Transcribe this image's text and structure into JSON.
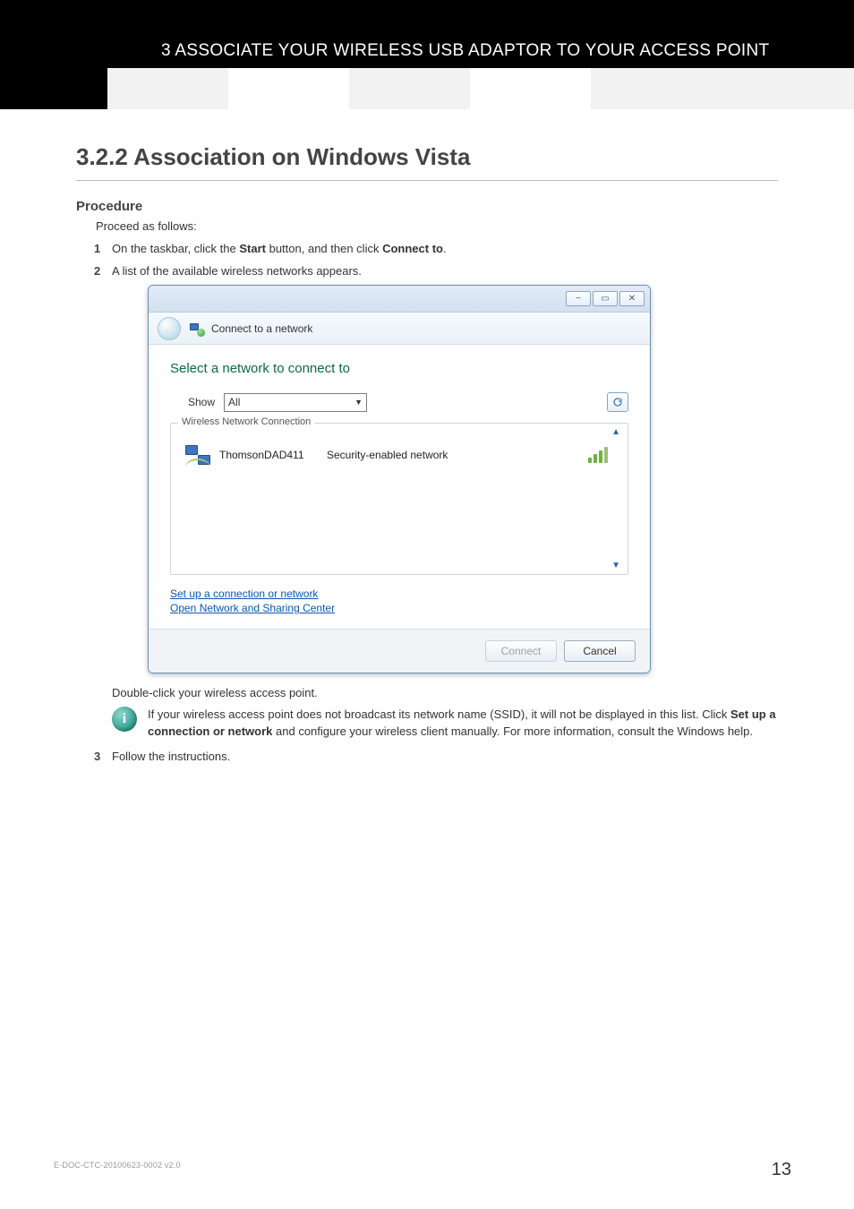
{
  "header": {
    "chapter_title": "3 ASSOCIATE YOUR WIRELESS USB ADAPTOR TO YOUR ACCESS POINT"
  },
  "section": {
    "heading": "3.2.2  Association on Windows Vista",
    "procedure_label": "Procedure",
    "intro": "Proceed as follows:",
    "step1_num": "1",
    "step1_pre": "On the taskbar, click the ",
    "step1_bold1": "Start",
    "step1_mid": " button, and then click ",
    "step1_bold2": "Connect to",
    "step1_post": ".",
    "step2_num": "2",
    "step2_text": "A list of the available wireless networks appears.",
    "dblclick": "Double-click your wireless access point.",
    "note_pre": "If your wireless access point does not broadcast its network name (SSID), it will not be displayed in this list. Click ",
    "note_bold": "Set up a connection or network",
    "note_post": " and configure your wireless client manually. For more information, consult the Windows help.",
    "step3_num": "3",
    "step3_text": "Follow the instructions."
  },
  "vista": {
    "title": "Connect to a network",
    "heading": "Select a network to connect to",
    "show_label": "Show",
    "show_value": "All",
    "group_label": "Wireless Network Connection",
    "net_name": "ThomsonDAD411",
    "net_desc": "Security-enabled network",
    "link1": "Set up a connection or network",
    "link2": "Open Network and Sharing Center",
    "btn_connect": "Connect",
    "btn_cancel": "Cancel",
    "min_glyph": "−",
    "max_glyph": "▭",
    "close_glyph": "✕",
    "back_glyph": "←",
    "up_glyph": "▲",
    "down_glyph": "▼",
    "combo_arrow": "▼"
  },
  "footer": {
    "docid": "E-DOC-CTC-20100623-0002 v2.0",
    "page": "13"
  },
  "info_glyph": "i"
}
